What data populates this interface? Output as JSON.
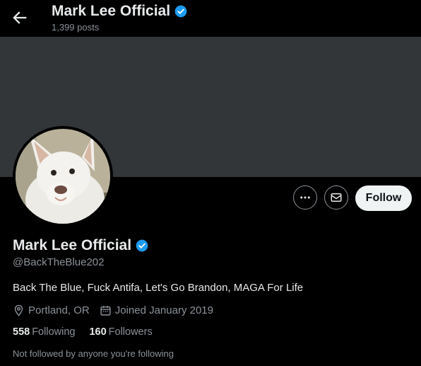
{
  "header": {
    "title": "Mark Lee Official",
    "posts": "1,399 posts"
  },
  "profile": {
    "name": "Mark Lee Official",
    "handle": "@BackTheBlue202",
    "bio": "Back The Blue, Fuck Antifa, Let's Go Brandon, MAGA For Life",
    "location": "Portland, OR",
    "joined": "Joined January 2019",
    "following_count": "558",
    "following_label": "Following",
    "followers_count": "160",
    "followers_label": "Followers",
    "note": "Not followed by anyone you're following"
  },
  "actions": {
    "follow_label": "Follow"
  },
  "colors": {
    "verified": "#1d9bf0",
    "background": "#000000",
    "banner": "#333639",
    "muted": "#8b9299"
  },
  "icons": [
    "back-arrow-icon",
    "verified-badge-icon",
    "more-icon",
    "message-icon",
    "location-pin-icon",
    "calendar-icon"
  ]
}
